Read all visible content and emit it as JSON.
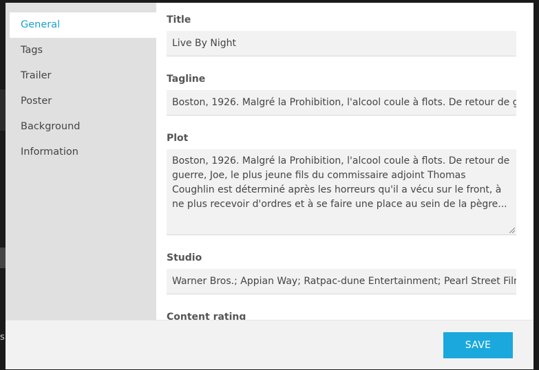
{
  "sidebar": {
    "items": [
      {
        "label": "General",
        "active": true
      },
      {
        "label": "Tags",
        "active": false
      },
      {
        "label": "Trailer",
        "active": false
      },
      {
        "label": "Poster",
        "active": false
      },
      {
        "label": "Background",
        "active": false
      },
      {
        "label": "Information",
        "active": false
      }
    ]
  },
  "form": {
    "title": {
      "label": "Title",
      "value": "Live By Night"
    },
    "tagline": {
      "label": "Tagline",
      "value": "Boston, 1926. Malgré la Prohibition, l'alcool coule à flots. De retour de guerre"
    },
    "plot": {
      "label": "Plot",
      "value": "Boston, 1926. Malgré la Prohibition, l'alcool coule à flots. De retour de guerre, Joe, le plus jeune fils du commissaire adjoint Thomas Coughlin est déterminé après les horreurs qu'il a vécu sur le front, à ne plus recevoir d'ordres et à se faire une place au sein de la pègre..."
    },
    "studio": {
      "label": "Studio",
      "value": "Warner Bros.; Appian Way; Ratpac-dune Entertainment; Pearl Street Films"
    },
    "content_rating": {
      "label": "Content rating",
      "value": ""
    }
  },
  "footer": {
    "save_label": "SAVE"
  },
  "backdrop": {
    "fragment_text": "s"
  },
  "colors": {
    "accent": "#1ba8dd",
    "active_nav": "#1ba0cf",
    "sidebar_bg": "#e0e0e0"
  }
}
